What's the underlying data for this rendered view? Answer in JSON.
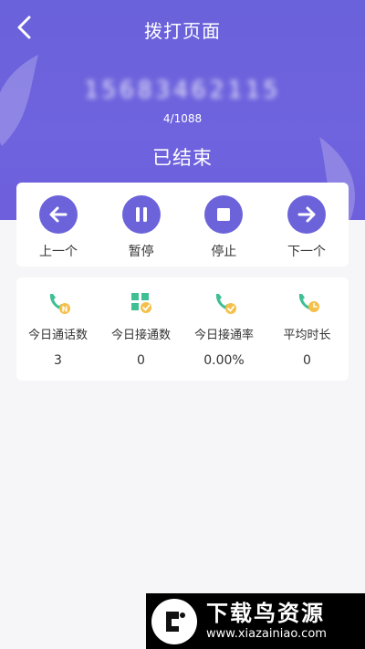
{
  "header": {
    "title": "拨打页面"
  },
  "call": {
    "phone_number": "15683462115",
    "progress": "4/1088",
    "status": "已结束"
  },
  "controls": {
    "prev_label": "上一个",
    "pause_label": "暂停",
    "stop_label": "停止",
    "next_label": "下一个"
  },
  "stats": [
    {
      "label": "今日通话数",
      "value": "3",
      "icon": "phone-n-icon"
    },
    {
      "label": "今日接通数",
      "value": "0",
      "icon": "grid-check-icon"
    },
    {
      "label": "今日接通率",
      "value": "0.00%",
      "icon": "phone-check-icon"
    },
    {
      "label": "平均时长",
      "value": "0",
      "icon": "phone-clock-icon"
    }
  ],
  "watermark": {
    "title": "下载鸟资源",
    "url": "www.xiazainiao.com"
  },
  "colors": {
    "primary": "#6c63db",
    "icon_green": "#3fbf93",
    "icon_yellow": "#f5c04a"
  }
}
